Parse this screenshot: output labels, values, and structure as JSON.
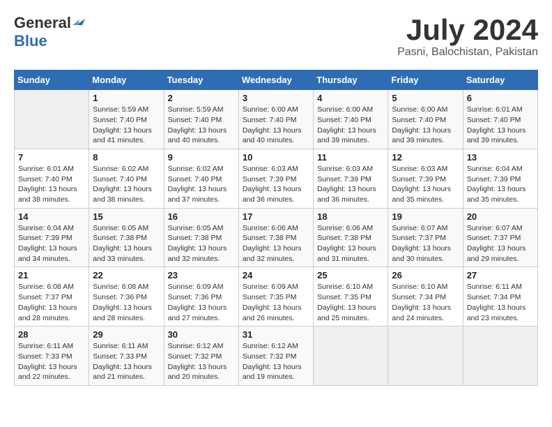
{
  "header": {
    "logo_general": "General",
    "logo_blue": "Blue",
    "month_year": "July 2024",
    "location": "Pasni, Balochistan, Pakistan"
  },
  "days_of_week": [
    "Sunday",
    "Monday",
    "Tuesday",
    "Wednesday",
    "Thursday",
    "Friday",
    "Saturday"
  ],
  "weeks": [
    [
      {
        "day": "",
        "sunrise": "",
        "sunset": "",
        "daylight": ""
      },
      {
        "day": "1",
        "sunrise": "Sunrise: 5:59 AM",
        "sunset": "Sunset: 7:40 PM",
        "daylight": "Daylight: 13 hours and 41 minutes."
      },
      {
        "day": "2",
        "sunrise": "Sunrise: 5:59 AM",
        "sunset": "Sunset: 7:40 PM",
        "daylight": "Daylight: 13 hours and 40 minutes."
      },
      {
        "day": "3",
        "sunrise": "Sunrise: 6:00 AM",
        "sunset": "Sunset: 7:40 PM",
        "daylight": "Daylight: 13 hours and 40 minutes."
      },
      {
        "day": "4",
        "sunrise": "Sunrise: 6:00 AM",
        "sunset": "Sunset: 7:40 PM",
        "daylight": "Daylight: 13 hours and 39 minutes."
      },
      {
        "day": "5",
        "sunrise": "Sunrise: 6:00 AM",
        "sunset": "Sunset: 7:40 PM",
        "daylight": "Daylight: 13 hours and 39 minutes."
      },
      {
        "day": "6",
        "sunrise": "Sunrise: 6:01 AM",
        "sunset": "Sunset: 7:40 PM",
        "daylight": "Daylight: 13 hours and 39 minutes."
      }
    ],
    [
      {
        "day": "7",
        "sunrise": "Sunrise: 6:01 AM",
        "sunset": "Sunset: 7:40 PM",
        "daylight": "Daylight: 13 hours and 38 minutes."
      },
      {
        "day": "8",
        "sunrise": "Sunrise: 6:02 AM",
        "sunset": "Sunset: 7:40 PM",
        "daylight": "Daylight: 13 hours and 38 minutes."
      },
      {
        "day": "9",
        "sunrise": "Sunrise: 6:02 AM",
        "sunset": "Sunset: 7:40 PM",
        "daylight": "Daylight: 13 hours and 37 minutes."
      },
      {
        "day": "10",
        "sunrise": "Sunrise: 6:03 AM",
        "sunset": "Sunset: 7:39 PM",
        "daylight": "Daylight: 13 hours and 36 minutes."
      },
      {
        "day": "11",
        "sunrise": "Sunrise: 6:03 AM",
        "sunset": "Sunset: 7:39 PM",
        "daylight": "Daylight: 13 hours and 36 minutes."
      },
      {
        "day": "12",
        "sunrise": "Sunrise: 6:03 AM",
        "sunset": "Sunset: 7:39 PM",
        "daylight": "Daylight: 13 hours and 35 minutes."
      },
      {
        "day": "13",
        "sunrise": "Sunrise: 6:04 AM",
        "sunset": "Sunset: 7:39 PM",
        "daylight": "Daylight: 13 hours and 35 minutes."
      }
    ],
    [
      {
        "day": "14",
        "sunrise": "Sunrise: 6:04 AM",
        "sunset": "Sunset: 7:39 PM",
        "daylight": "Daylight: 13 hours and 34 minutes."
      },
      {
        "day": "15",
        "sunrise": "Sunrise: 6:05 AM",
        "sunset": "Sunset: 7:38 PM",
        "daylight": "Daylight: 13 hours and 33 minutes."
      },
      {
        "day": "16",
        "sunrise": "Sunrise: 6:05 AM",
        "sunset": "Sunset: 7:38 PM",
        "daylight": "Daylight: 13 hours and 32 minutes."
      },
      {
        "day": "17",
        "sunrise": "Sunrise: 6:06 AM",
        "sunset": "Sunset: 7:38 PM",
        "daylight": "Daylight: 13 hours and 32 minutes."
      },
      {
        "day": "18",
        "sunrise": "Sunrise: 6:06 AM",
        "sunset": "Sunset: 7:38 PM",
        "daylight": "Daylight: 13 hours and 31 minutes."
      },
      {
        "day": "19",
        "sunrise": "Sunrise: 6:07 AM",
        "sunset": "Sunset: 7:37 PM",
        "daylight": "Daylight: 13 hours and 30 minutes."
      },
      {
        "day": "20",
        "sunrise": "Sunrise: 6:07 AM",
        "sunset": "Sunset: 7:37 PM",
        "daylight": "Daylight: 13 hours and 29 minutes."
      }
    ],
    [
      {
        "day": "21",
        "sunrise": "Sunrise: 6:08 AM",
        "sunset": "Sunset: 7:37 PM",
        "daylight": "Daylight: 13 hours and 28 minutes."
      },
      {
        "day": "22",
        "sunrise": "Sunrise: 6:08 AM",
        "sunset": "Sunset: 7:36 PM",
        "daylight": "Daylight: 13 hours and 28 minutes."
      },
      {
        "day": "23",
        "sunrise": "Sunrise: 6:09 AM",
        "sunset": "Sunset: 7:36 PM",
        "daylight": "Daylight: 13 hours and 27 minutes."
      },
      {
        "day": "24",
        "sunrise": "Sunrise: 6:09 AM",
        "sunset": "Sunset: 7:35 PM",
        "daylight": "Daylight: 13 hours and 26 minutes."
      },
      {
        "day": "25",
        "sunrise": "Sunrise: 6:10 AM",
        "sunset": "Sunset: 7:35 PM",
        "daylight": "Daylight: 13 hours and 25 minutes."
      },
      {
        "day": "26",
        "sunrise": "Sunrise: 6:10 AM",
        "sunset": "Sunset: 7:34 PM",
        "daylight": "Daylight: 13 hours and 24 minutes."
      },
      {
        "day": "27",
        "sunrise": "Sunrise: 6:11 AM",
        "sunset": "Sunset: 7:34 PM",
        "daylight": "Daylight: 13 hours and 23 minutes."
      }
    ],
    [
      {
        "day": "28",
        "sunrise": "Sunrise: 6:11 AM",
        "sunset": "Sunset: 7:33 PM",
        "daylight": "Daylight: 13 hours and 22 minutes."
      },
      {
        "day": "29",
        "sunrise": "Sunrise: 6:11 AM",
        "sunset": "Sunset: 7:33 PM",
        "daylight": "Daylight: 13 hours and 21 minutes."
      },
      {
        "day": "30",
        "sunrise": "Sunrise: 6:12 AM",
        "sunset": "Sunset: 7:32 PM",
        "daylight": "Daylight: 13 hours and 20 minutes."
      },
      {
        "day": "31",
        "sunrise": "Sunrise: 6:12 AM",
        "sunset": "Sunset: 7:32 PM",
        "daylight": "Daylight: 13 hours and 19 minutes."
      },
      {
        "day": "",
        "sunrise": "",
        "sunset": "",
        "daylight": ""
      },
      {
        "day": "",
        "sunrise": "",
        "sunset": "",
        "daylight": ""
      },
      {
        "day": "",
        "sunrise": "",
        "sunset": "",
        "daylight": ""
      }
    ]
  ]
}
